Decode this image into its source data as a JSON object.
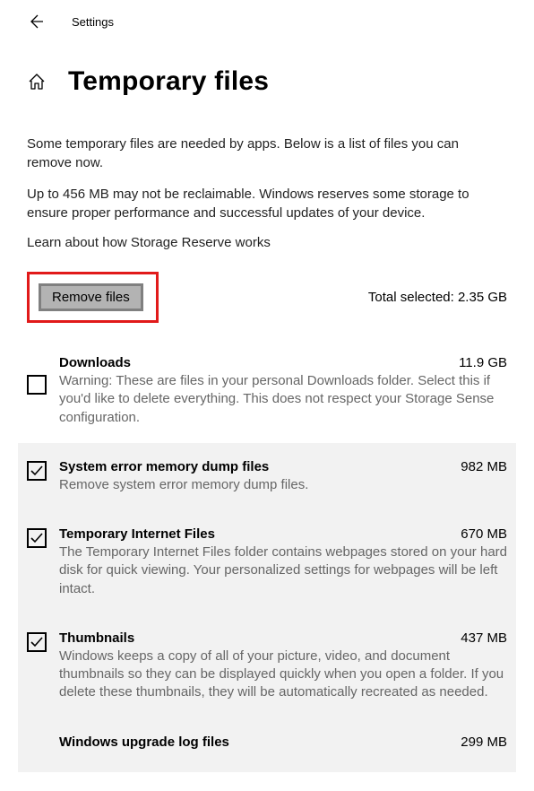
{
  "header": {
    "label": "Settings"
  },
  "title": "Temporary files",
  "intro1": "Some temporary files are needed by apps. Below is a list of files you can remove now.",
  "intro2": "Up to 456 MB may not be reclaimable. Windows reserves some storage to ensure proper performance and successful updates of your device.",
  "link": "Learn about how Storage Reserve works",
  "remove_button": "Remove files",
  "total_selected": "Total selected: 2.35 GB",
  "items": [
    {
      "title": "Downloads",
      "size": "11.9 GB",
      "desc": "Warning: These are files in your personal Downloads folder. Select this if you'd like to delete everything. This does not respect your Storage Sense configuration.",
      "checked": false
    },
    {
      "title": "System error memory dump files",
      "size": "982 MB",
      "desc": "Remove system error memory dump files.",
      "checked": true
    },
    {
      "title": "Temporary Internet Files",
      "size": "670 MB",
      "desc": "The Temporary Internet Files folder contains webpages stored on your hard disk for quick viewing. Your personalized settings for webpages will be left intact.",
      "checked": true
    },
    {
      "title": "Thumbnails",
      "size": "437 MB",
      "desc": "Windows keeps a copy of all of your picture, video, and document thumbnails so they can be displayed quickly when you open a folder. If you delete these thumbnails, they will be automatically recreated as needed.",
      "checked": true
    },
    {
      "title": "Windows upgrade log files",
      "size": "299 MB",
      "desc": "",
      "checked": true
    }
  ]
}
